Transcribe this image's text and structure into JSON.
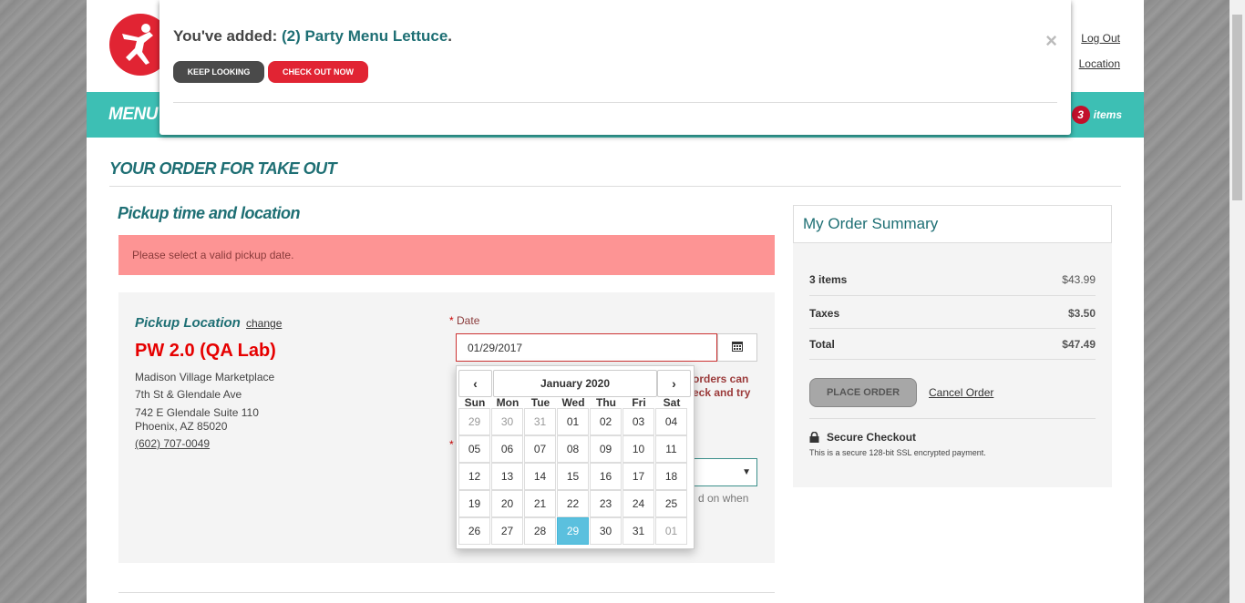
{
  "header": {
    "links": [
      "Log Out",
      "Location"
    ]
  },
  "nav": {
    "label": "MENU",
    "cart_count": "3",
    "cart_label": "items"
  },
  "order_title": "YOUR ORDER FOR TAKE OUT",
  "pickup": {
    "section_title": "Pickup time and location",
    "alert": "Please select a valid pickup date.",
    "location_label": "Pickup Location",
    "change_link": "change",
    "store_name": "PW 2.0 (QA Lab)",
    "address_lines": [
      "Madison Village Marketplace",
      "7th St & Glendale Ave",
      "742 E Glendale Suite 110",
      "Phoenix, AZ 85020"
    ],
    "phone": "(602) 707-0049",
    "date_label": "Date",
    "date_value": "01/29/2017",
    "warning_lines": [
      "orders can",
      "eck and try"
    ],
    "time_note": "d on when"
  },
  "modal": {
    "prefix": "You've added: ",
    "product": "(2) Party Menu Lettuce",
    "suffix": ".",
    "keep_looking": "KEEP LOOKING",
    "check_out": "CHECK OUT NOW",
    "close": "×"
  },
  "datepicker": {
    "month": "January 2020",
    "prev": "‹",
    "next": "›",
    "dow": [
      "Sun",
      "Mon",
      "Tue",
      "Wed",
      "Thu",
      "Fri",
      "Sat"
    ],
    "weeks": [
      [
        "29",
        "30",
        "31",
        "01",
        "02",
        "03",
        "04"
      ],
      [
        "05",
        "06",
        "07",
        "08",
        "09",
        "10",
        "11"
      ],
      [
        "12",
        "13",
        "14",
        "15",
        "16",
        "17",
        "18"
      ],
      [
        "19",
        "20",
        "21",
        "22",
        "23",
        "24",
        "25"
      ],
      [
        "26",
        "27",
        "28",
        "29",
        "30",
        "31",
        "01"
      ]
    ],
    "muted_days": [
      "0-0",
      "0-1",
      "0-2",
      "4-6"
    ],
    "selected_day": "4-3"
  },
  "summary": {
    "title": "My Order Summary",
    "rows": [
      {
        "label": "3 items",
        "value": "$43.99"
      },
      {
        "label": "Taxes",
        "value": "$3.50"
      },
      {
        "label": "Total",
        "value": "$47.49"
      }
    ],
    "place_order": "PLACE ORDER",
    "cancel_order": "Cancel Order",
    "secure_title": "Secure Checkout",
    "secure_text": "This is a secure 128-bit SSL encrypted payment."
  },
  "colors": {
    "brand_teal": "#3dbfb4",
    "brand_red": "#e12433",
    "heading_teal": "#1e6f74",
    "selected_day": "#5bc0de"
  }
}
